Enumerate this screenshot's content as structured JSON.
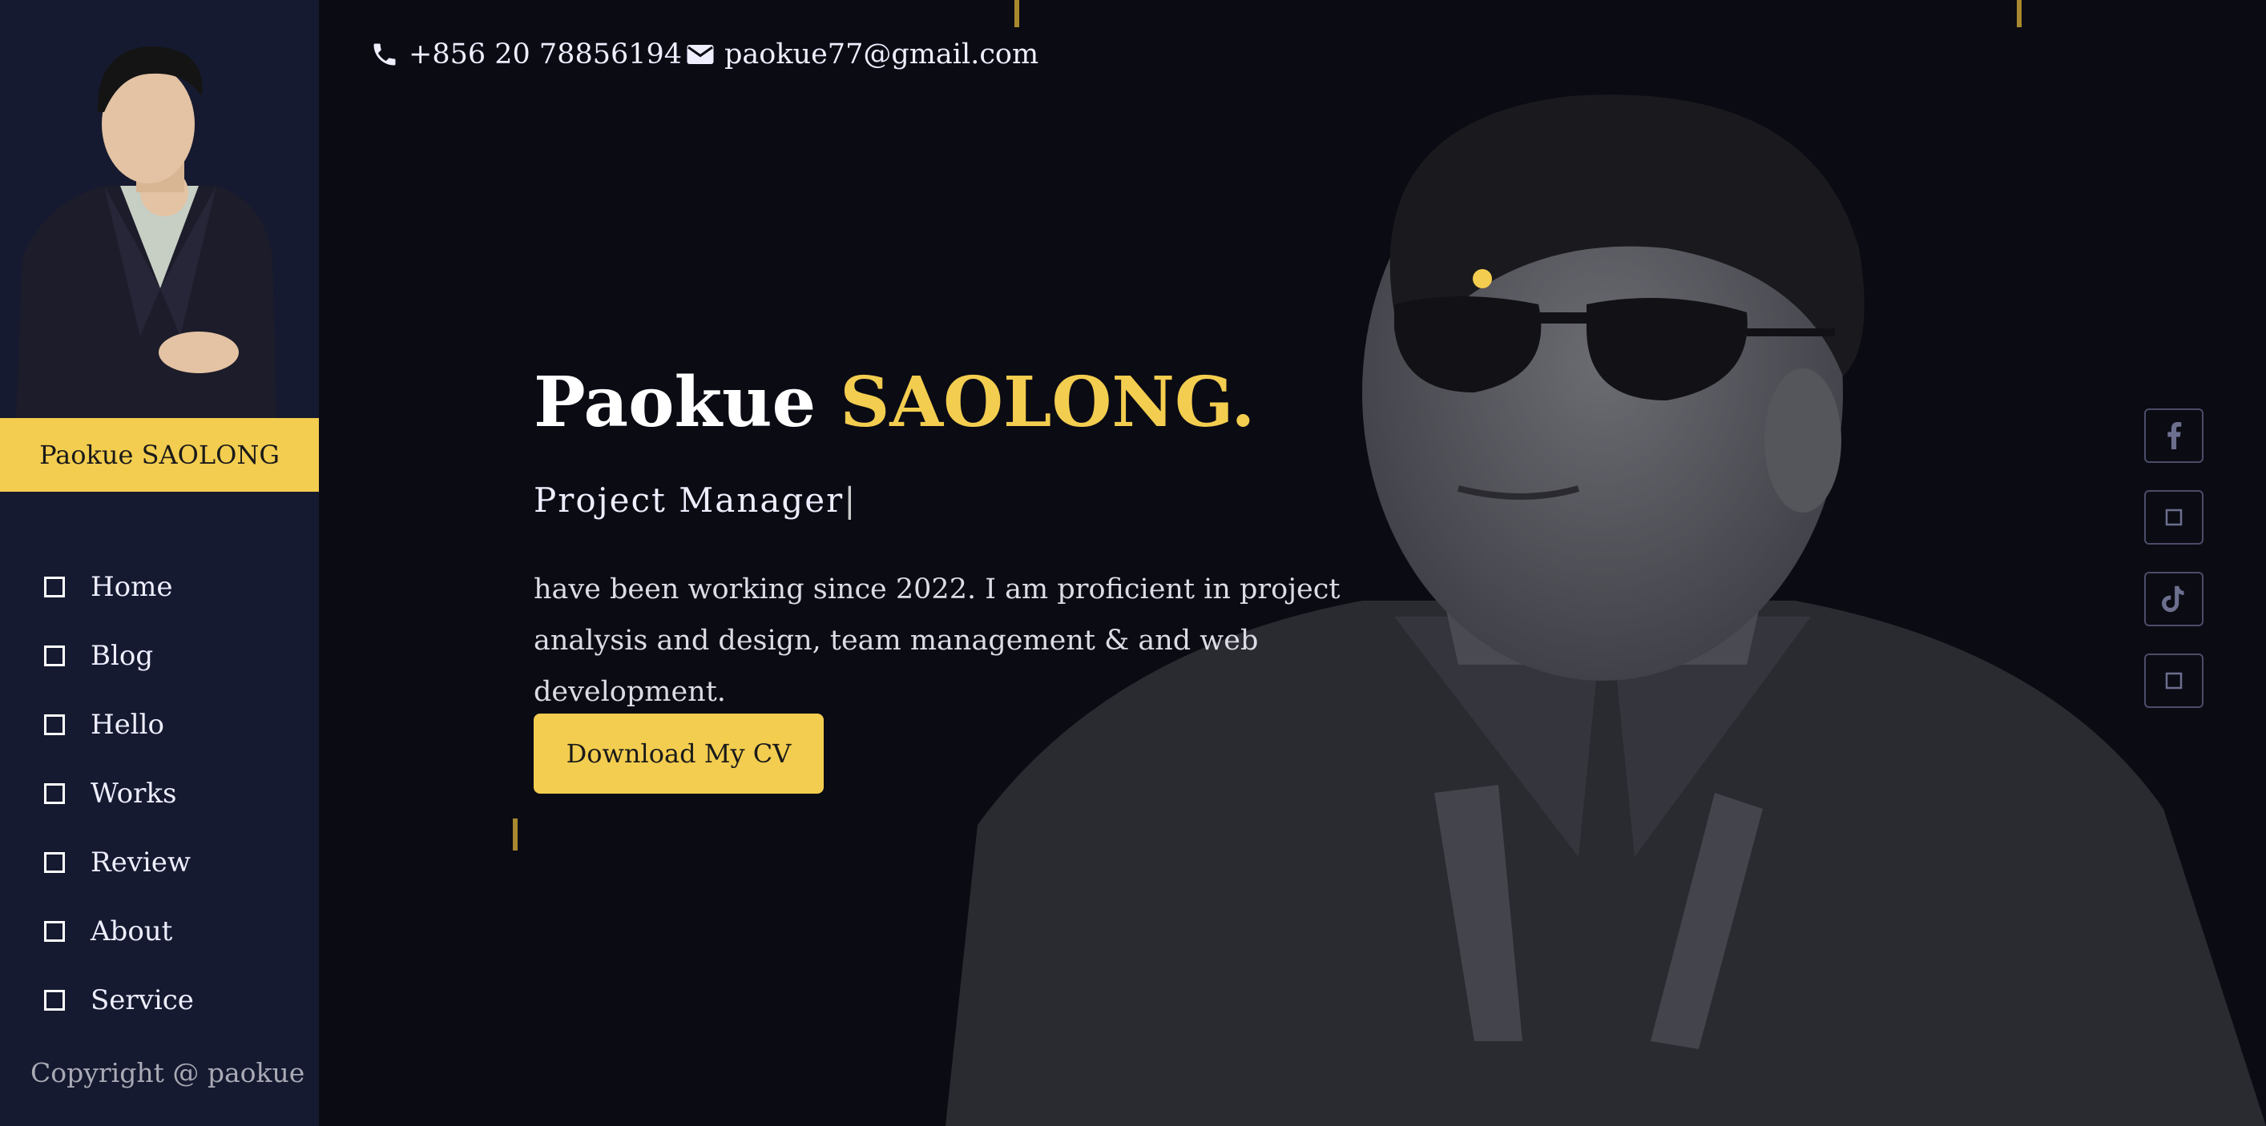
{
  "sidebar": {
    "name": "Paokue SAOLONG",
    "nav": [
      "Home",
      "Blog",
      "Hello",
      "Works",
      "Review",
      "About",
      "Service"
    ],
    "copyright": "Copyright @ paokue"
  },
  "header": {
    "phone": "+856 20 78856194",
    "email": "paokue77@gmail.com"
  },
  "hero": {
    "first_name": "Paokue",
    "last_name": "SAOLONG.",
    "role": "Project Manager",
    "caret": "|",
    "description": "have been working since 2022. I am proficient in project analysis and design, team management & and web development.",
    "cta": "Download My CV"
  },
  "social": [
    "facebook-icon",
    "square-icon",
    "tiktok-icon",
    "square-icon"
  ],
  "colors": {
    "accent": "#f3cd4f",
    "sidebar": "#161a30",
    "background": "#0b0b14"
  }
}
